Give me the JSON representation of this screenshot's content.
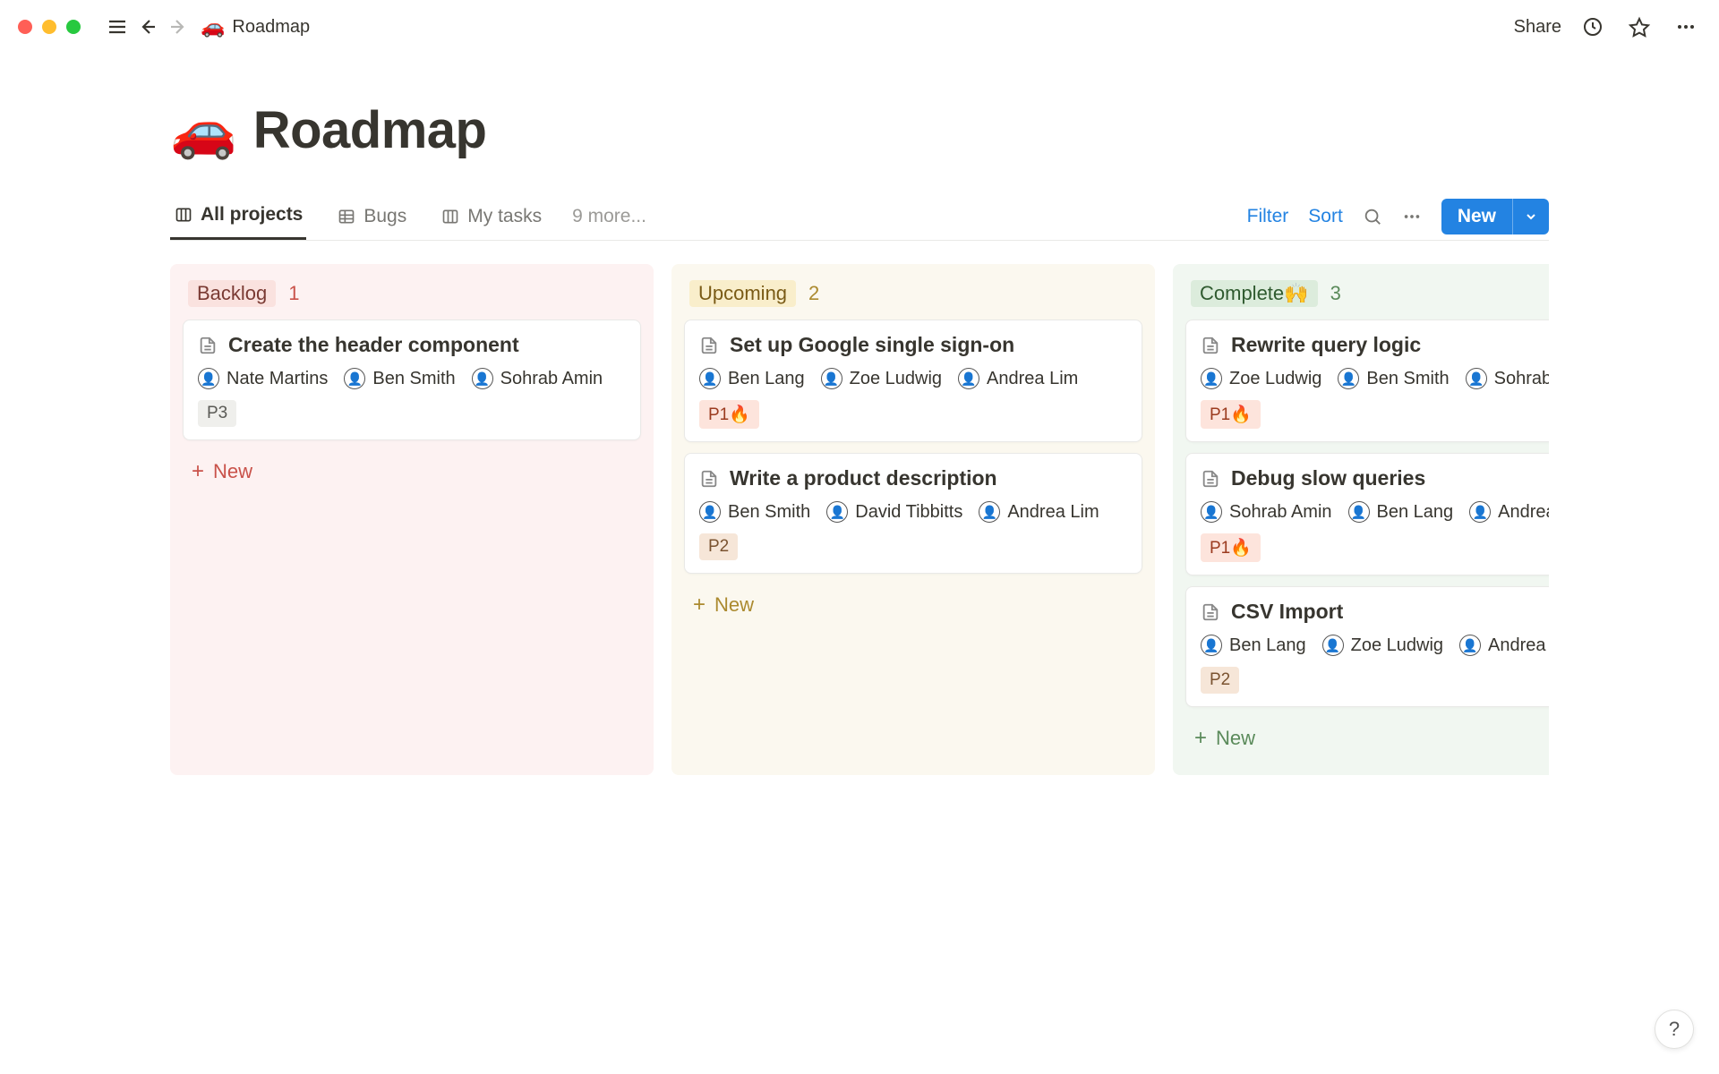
{
  "breadcrumb": {
    "icon": "🚗",
    "title": "Roadmap"
  },
  "topbar": {
    "share": "Share"
  },
  "page": {
    "icon": "🚗",
    "title": "Roadmap"
  },
  "tabs": {
    "items": [
      {
        "label": "All projects",
        "icon": "board",
        "active": true
      },
      {
        "label": "Bugs",
        "icon": "table",
        "active": false
      },
      {
        "label": "My tasks",
        "icon": "board",
        "active": false
      }
    ],
    "more": "9 more..."
  },
  "toolbar": {
    "filter": "Filter",
    "sort": "Sort",
    "new": "New"
  },
  "columns": [
    {
      "key": "backlog",
      "label": "Backlog",
      "count": "1",
      "cards": [
        {
          "title": "Create the header component",
          "people": [
            "Nate Martins",
            "Ben Smith",
            "Sohrab Amin"
          ],
          "priority": "P3",
          "priority_class": "p3"
        }
      ],
      "new_label": "New"
    },
    {
      "key": "upcoming",
      "label": "Upcoming",
      "count": "2",
      "cards": [
        {
          "title": "Set up Google single sign-on",
          "people": [
            "Ben Lang",
            "Zoe Ludwig",
            "Andrea Lim"
          ],
          "priority": "P1🔥",
          "priority_class": "p1"
        },
        {
          "title": "Write a product description",
          "people": [
            "Ben Smith",
            "David Tibbitts",
            "Andrea Lim"
          ],
          "priority": "P2",
          "priority_class": "p2"
        }
      ],
      "new_label": "New"
    },
    {
      "key": "complete",
      "label": "Complete🙌",
      "count": "3",
      "cards": [
        {
          "title": "Rewrite query logic",
          "people": [
            "Zoe Ludwig",
            "Ben Smith",
            "Sohrab Amin"
          ],
          "priority": "P1🔥",
          "priority_class": "p1"
        },
        {
          "title": "Debug slow queries",
          "people": [
            "Sohrab Amin",
            "Ben Lang",
            "Andrea Lim"
          ],
          "priority": "P1🔥",
          "priority_class": "p1"
        },
        {
          "title": "CSV Import",
          "people": [
            "Ben Lang",
            "Zoe Ludwig",
            "Andrea Lim"
          ],
          "priority": "P2",
          "priority_class": "p2"
        }
      ],
      "new_label": "New"
    }
  ],
  "help": "?"
}
